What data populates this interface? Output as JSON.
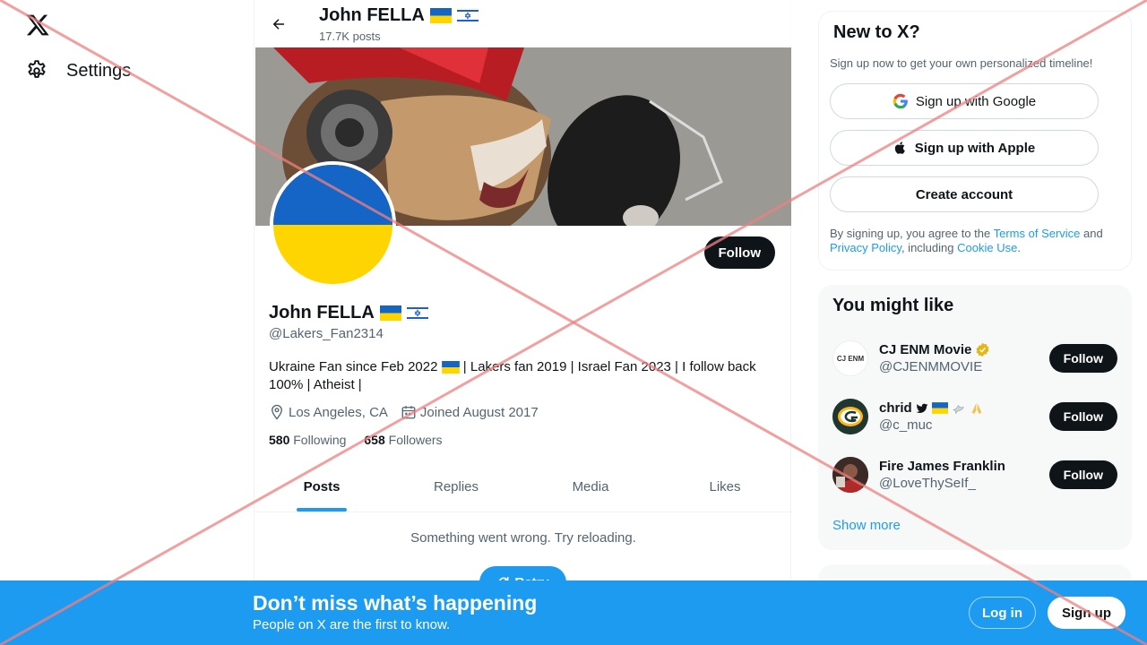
{
  "nav": {
    "settings_label": "Settings"
  },
  "profile": {
    "top_title": "John FELLA",
    "top_posts": "17.7K posts",
    "name": "John FELLA",
    "handle": "@Lakers_Fan2314",
    "bio_part1": "Ukraine Fan since Feb 2022",
    "bio_part2": "| Lakers fan 2019 | Israel Fan 2023 | I follow back 100% | Atheist |",
    "location": "Los Angeles, CA",
    "joined": "Joined August 2017",
    "following_count": "580",
    "following_label": "Following",
    "followers_count": "658",
    "followers_label": "Followers",
    "follow_label": "Follow"
  },
  "tabs": [
    {
      "label": "Posts"
    },
    {
      "label": "Replies"
    },
    {
      "label": "Media"
    },
    {
      "label": "Likes"
    }
  ],
  "feed": {
    "error": "Something went wrong. Try reloading.",
    "retry_label": "Retry"
  },
  "signup_card": {
    "title": "New to X?",
    "subtitle": "Sign up now to get your own personalized timeline!",
    "google_label": "Sign up with Google",
    "apple_label": "Sign up with Apple",
    "create_label": "Create account",
    "legal_prefix": "By signing up, you agree to the ",
    "terms_link": "Terms of Service",
    "legal_and": " and ",
    "privacy_link": "Privacy Policy",
    "legal_including": ", including ",
    "cookie_link": "Cookie Use",
    "legal_end": "."
  },
  "suggestions": {
    "title": "You might like",
    "users": [
      {
        "name": "CJ ENM Movie",
        "handle": "@CJENMMOVIE",
        "follow": "Follow",
        "avatar_text": "CJ ENM"
      },
      {
        "name": "chrid",
        "handle": "@c_muc",
        "follow": "Follow"
      },
      {
        "name": "Fire James Franklin",
        "handle": "@LoveThySeIf_",
        "follow": "Follow"
      }
    ],
    "show_more": "Show more"
  },
  "bottom_bar": {
    "title": "Don’t miss what’s happening",
    "subtitle": "People on X are the first to know.",
    "login_label": "Log in",
    "signup_label": "Sign up"
  },
  "colors": {
    "accent": "#1d9bf0",
    "dark": "#0f1419",
    "muted": "#536471",
    "ukraine_blue": "#1565c7",
    "ukraine_yellow": "#ffd500",
    "overlay_cross": "#f08080"
  }
}
